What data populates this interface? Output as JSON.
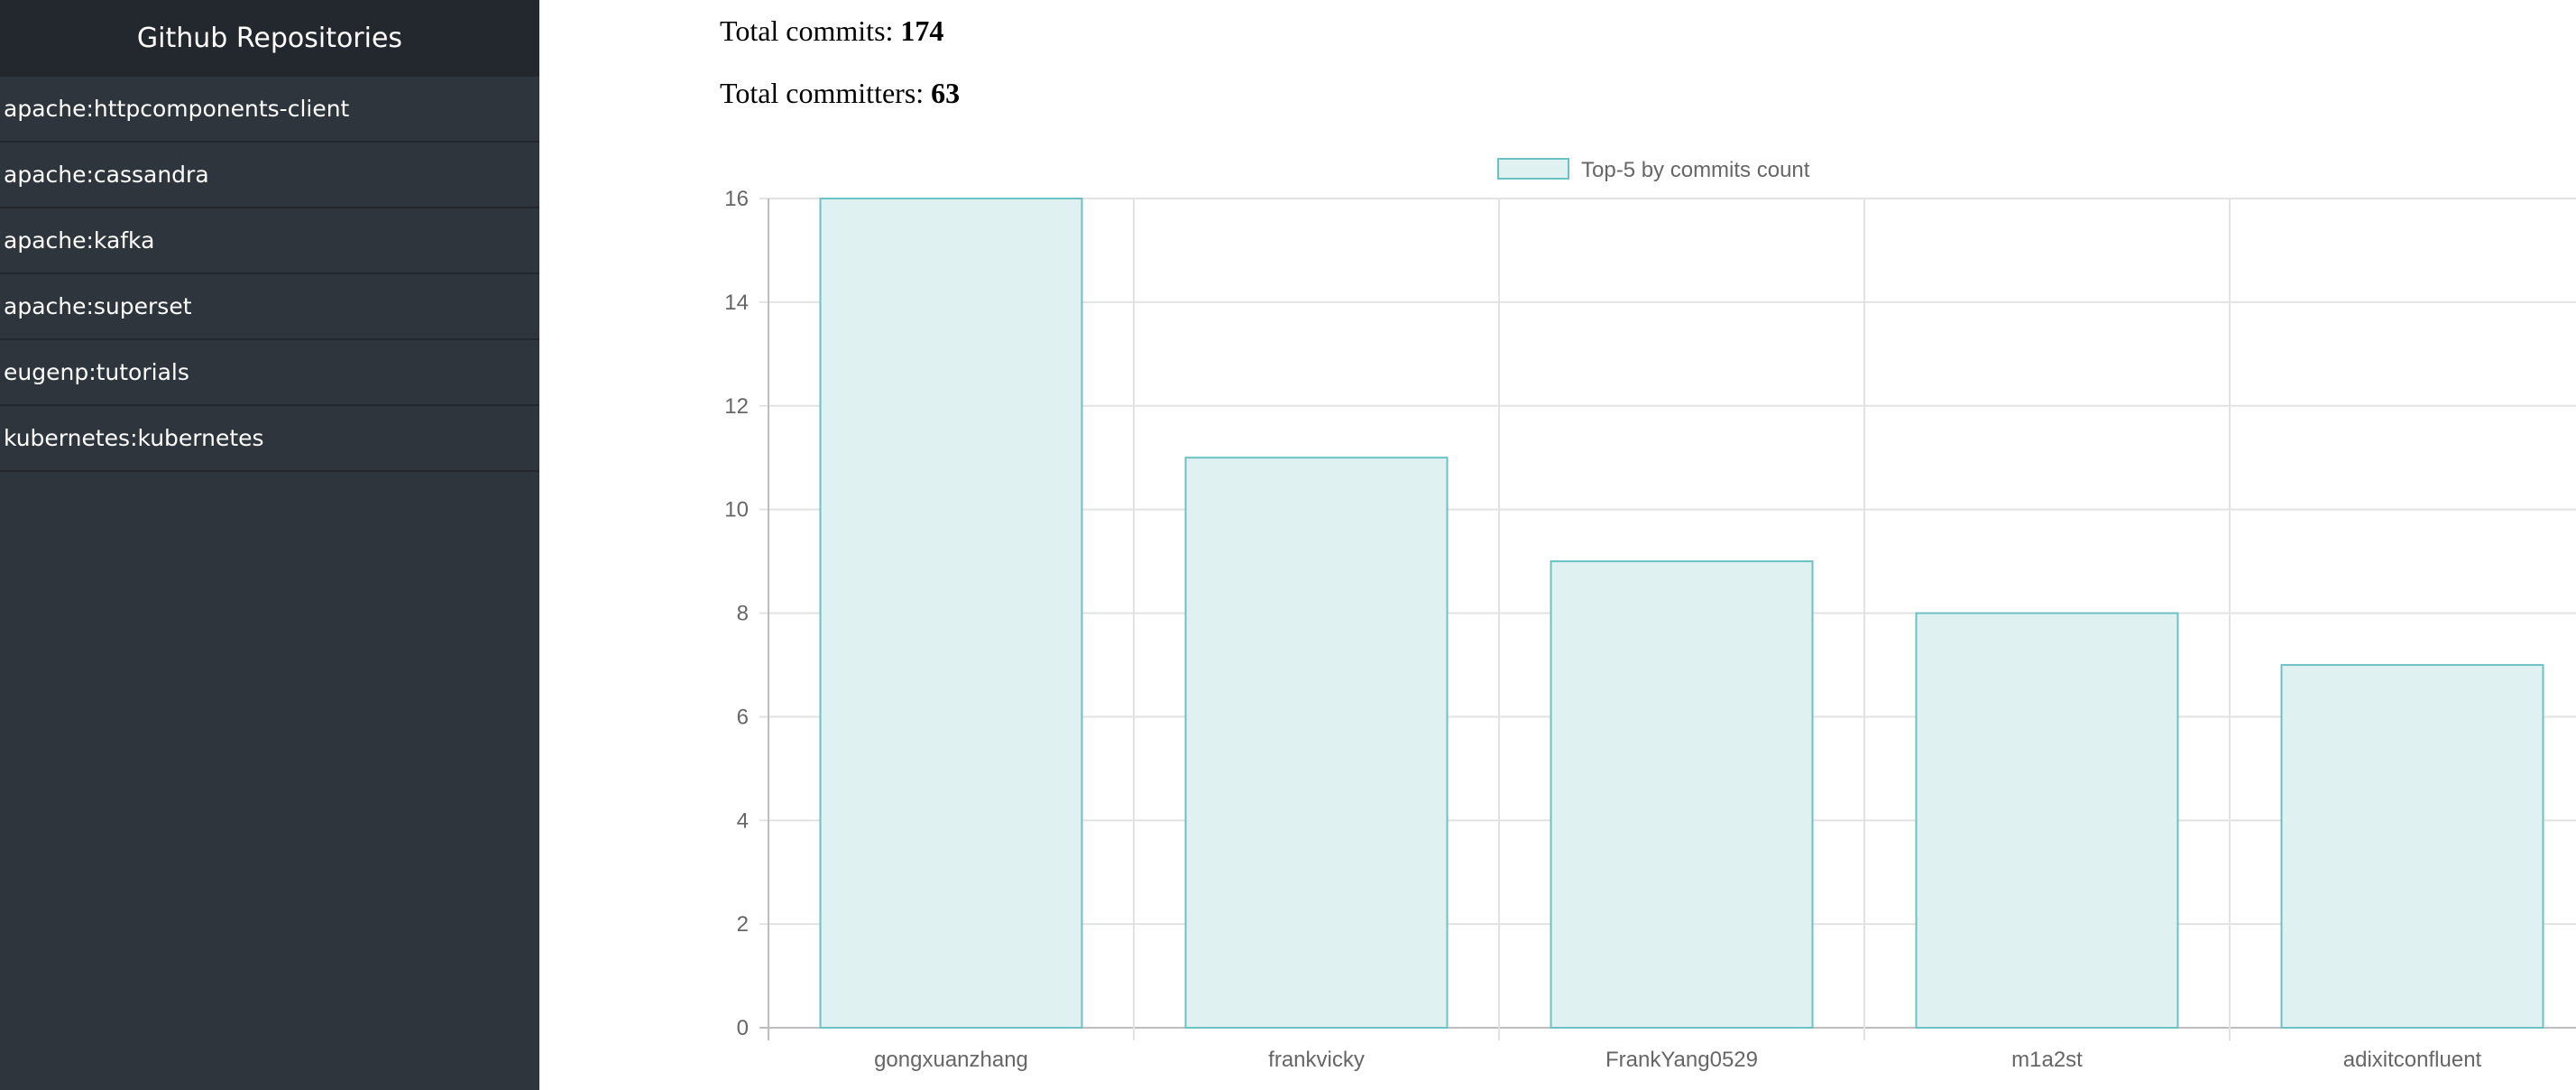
{
  "sidebar": {
    "title": "Github Repositories",
    "items": [
      {
        "label": "apache:httpcomponents-client"
      },
      {
        "label": "apache:cassandra"
      },
      {
        "label": "apache:kafka"
      },
      {
        "label": "apache:superset"
      },
      {
        "label": "eugenp:tutorials"
      },
      {
        "label": "kubernetes:kubernetes"
      }
    ]
  },
  "stats": {
    "commits_label": "Total commits: ",
    "commits_value": "174",
    "committers_label": "Total committers: ",
    "committers_value": "63"
  },
  "colors": {
    "sidebar_bg": "#2e353c",
    "sidebar_header_bg": "#23282e",
    "bar_fill": "#e0f1f1",
    "bar_border": "#6cc2c3"
  },
  "chart_data": {
    "type": "bar",
    "categories": [
      "gongxuanzhang",
      "frankvicky",
      "FrankYang0529",
      "m1a2st",
      "adixitconfluent"
    ],
    "series": [
      {
        "name": "Top-5 by commits count",
        "values": [
          16,
          11,
          9,
          8,
          7
        ]
      }
    ],
    "ylim": [
      0,
      16
    ],
    "yticks": [
      0,
      2,
      4,
      6,
      8,
      10,
      12,
      14,
      16
    ],
    "grid": true,
    "legend": "top-center"
  }
}
